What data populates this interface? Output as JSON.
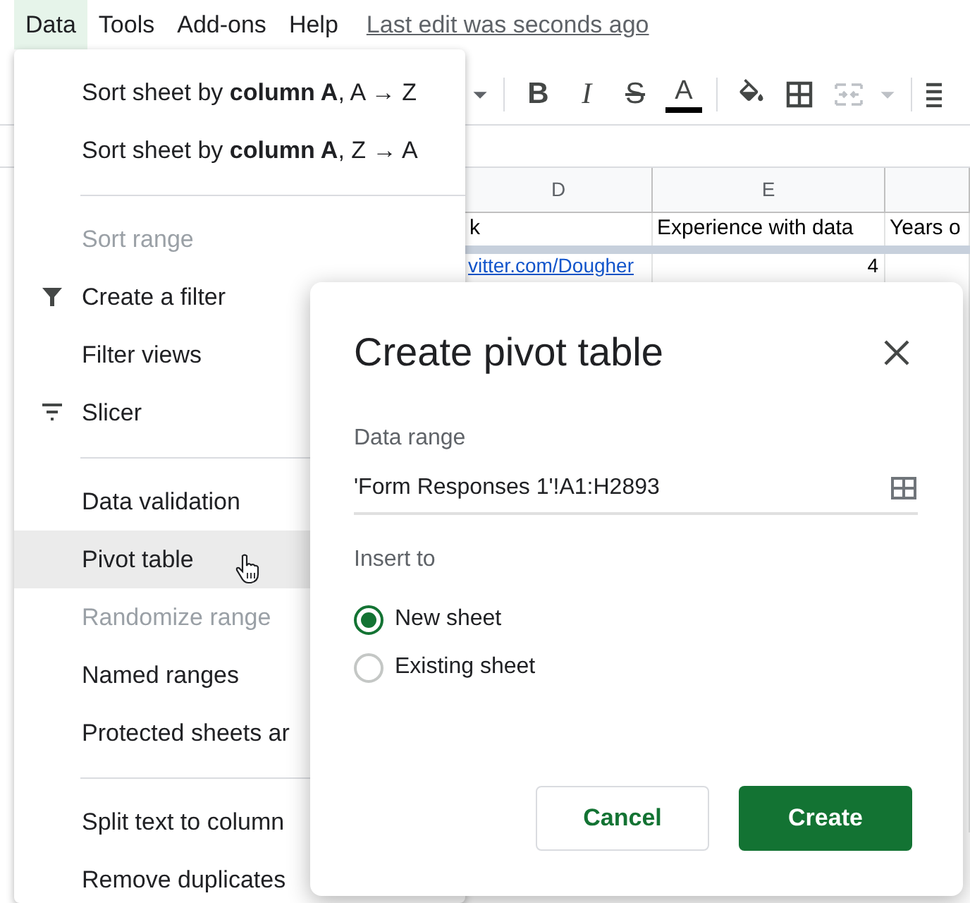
{
  "menubar": {
    "items": [
      {
        "label": "Data",
        "selected": true
      },
      {
        "label": "Tools",
        "selected": false
      },
      {
        "label": "Add-ons",
        "selected": false
      },
      {
        "label": "Help",
        "selected": false
      }
    ],
    "last_edit": "Last edit was seconds ago"
  },
  "toolbar": [
    {
      "kind": "caret",
      "disabled": false
    },
    {
      "kind": "divider"
    },
    {
      "kind": "bold",
      "text": "B"
    },
    {
      "kind": "italic",
      "text": "I"
    },
    {
      "kind": "strike",
      "text": "S"
    },
    {
      "kind": "color",
      "text": "A"
    },
    {
      "kind": "divider"
    },
    {
      "kind": "fill"
    },
    {
      "kind": "borders"
    },
    {
      "kind": "merge",
      "disabled": true
    },
    {
      "kind": "caret",
      "disabled": true
    },
    {
      "kind": "divider"
    },
    {
      "kind": "align"
    }
  ],
  "sheet": {
    "columns": [
      "D",
      "E"
    ],
    "rows": [
      [
        {
          "kind": "text",
          "text": "k"
        },
        {
          "kind": "text",
          "text": "Experience with data"
        },
        {
          "kind": "text",
          "text": "Years o"
        }
      ],
      [
        {
          "kind": "link",
          "text": "vitter.com/Dougher"
        },
        {
          "kind": "number",
          "text": "4"
        }
      ]
    ]
  },
  "menu": [
    {
      "kind": "item",
      "label": "Sort sheet by **column A**, A → Z",
      "disabled": false,
      "selected": false
    },
    {
      "kind": "item",
      "label": "Sort sheet by **column A**, Z → A",
      "disabled": false,
      "selected": false
    },
    {
      "kind": "divider"
    },
    {
      "kind": "item",
      "label": "Sort range",
      "disabled": true,
      "selected": false
    },
    {
      "kind": "filter",
      "label": "Create a filter",
      "disabled": false,
      "selected": false
    },
    {
      "kind": "item",
      "label": "Filter views",
      "disabled": false,
      "selected": false
    },
    {
      "kind": "slicer",
      "label": "Slicer",
      "disabled": false,
      "selected": false
    },
    {
      "kind": "divider"
    },
    {
      "kind": "item",
      "label": "Data validation",
      "disabled": false,
      "selected": false
    },
    {
      "kind": "item",
      "label": "Pivot table",
      "disabled": false,
      "selected": true
    },
    {
      "kind": "item",
      "label": "Randomize range",
      "disabled": true,
      "selected": false
    },
    {
      "kind": "item",
      "label": "Named ranges",
      "disabled": false,
      "selected": false
    },
    {
      "kind": "item",
      "label": "Protected sheets ar",
      "disabled": false,
      "selected": false
    },
    {
      "kind": "divider"
    },
    {
      "kind": "item",
      "label": "Split text to column",
      "disabled": false,
      "selected": false
    },
    {
      "kind": "item",
      "label": "Remove duplicates",
      "disabled": false,
      "selected": false
    }
  ],
  "dialog": {
    "title": "Create pivot table",
    "data_range": {
      "label": "Data range",
      "value": "'Form Responses 1'!A1:H2893"
    },
    "insert_to": {
      "label": "Insert to",
      "options": [
        {
          "label": "New sheet",
          "selected": true
        },
        {
          "label": "Existing sheet",
          "selected": false
        }
      ]
    },
    "buttons": [
      {
        "label": "Cancel",
        "kind": "secondary"
      },
      {
        "label": "Create",
        "kind": "primary"
      }
    ]
  }
}
